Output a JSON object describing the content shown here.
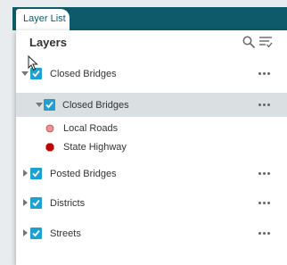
{
  "widget": {
    "tab_label": "Layer List",
    "panel_title": "Layers"
  },
  "toolbar": {
    "search_icon": "search-icon",
    "filter_icon": "filter-list-icon"
  },
  "layers": [
    {
      "name": "Closed Bridges",
      "checked": true,
      "expanded": true
    },
    {
      "name": "Closed Bridges",
      "checked": true,
      "expanded": true,
      "selected": true,
      "legend": [
        {
          "label": "Local Roads",
          "symbol": "circle",
          "color": "#f09090"
        },
        {
          "label": "State Highway",
          "symbol": "octagon",
          "color": "#c00000"
        }
      ]
    },
    {
      "name": "Posted Bridges",
      "checked": true,
      "expanded": false
    },
    {
      "name": "Districts",
      "checked": true,
      "expanded": false
    },
    {
      "name": "Streets",
      "checked": true,
      "expanded": false
    }
  ],
  "colors": {
    "header": "#0e5a6b",
    "checkbox": "#1ea0d2",
    "selected_row": "#dadfe2"
  }
}
